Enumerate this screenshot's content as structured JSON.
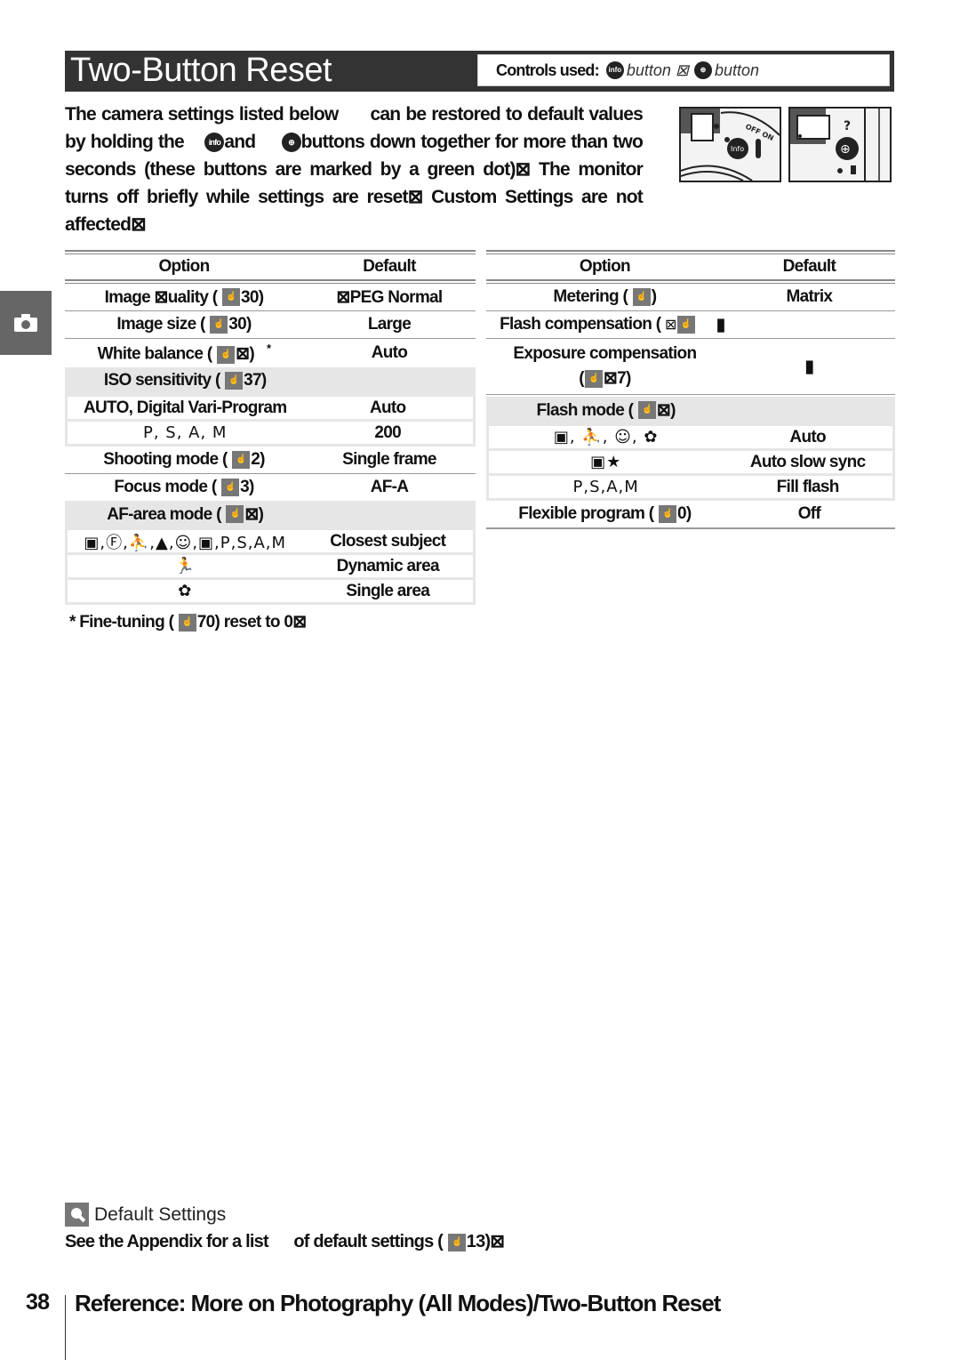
{
  "header": {
    "title": "Two-Button Reset",
    "controls_label": "Controls used:",
    "button1_icon": "info",
    "button1_text": "button ⊠",
    "button2_text": "button",
    "button2_icon": "zoom-in"
  },
  "intro": {
    "p1": "The camera settings listed below",
    "p2": "can be restored to default values by holding the",
    "p3": "and",
    "p4": "buttons down together for more than two seconds (these buttons are marked by a green dot)⊠  The monitor turns off briefly while settings are reset⊠  Custom Settings are not affected⊠",
    "info_icon": "info",
    "zoom_icon": "⊕"
  },
  "side_tab": {
    "icon": "camera-icon"
  },
  "tables": {
    "header": {
      "option": "Option",
      "default": "Default"
    },
    "page_icon": "☝",
    "left": {
      "rows": [
        {
          "option": "Image ⊠uality (",
          "ref": "30)",
          "default": "⊠PEG Normal"
        },
        {
          "option": "Image size (",
          "ref": "30)",
          "default": "Large"
        },
        {
          "option": "White balance (",
          "ref": "⊠)",
          "default": "Auto",
          "note": "*"
        }
      ],
      "iso": {
        "option": "ISO sensitivity (",
        "ref": "37)",
        "subs": [
          {
            "mode": "AUTO, Digital Vari-Program",
            "default": "Auto"
          },
          {
            "mode": "P, S, A, M",
            "default": "200"
          }
        ]
      },
      "rows2": [
        {
          "option": "Shooting mode (",
          "ref": "2)",
          "default": "Single frame"
        },
        {
          "option": "Focus mode (",
          "ref": "3)",
          "default": "AF-A"
        }
      ],
      "afarea": {
        "option": "AF-area mode (",
        "ref": "⊠)",
        "subs": [
          {
            "mode": "AUTO, ⚡̸, portrait, landscape, child, night portrait, P, S, A, M",
            "mode_glyphs": "▣,Ⓕ,⛹,▲,☺,▣,P,S,A,M",
            "default": "Closest subject"
          },
          {
            "mode": "sports",
            "mode_glyphs": "🏃",
            "default": "Dynamic area"
          },
          {
            "mode": "close up",
            "mode_glyphs": "✿",
            "default": "Single area"
          }
        ]
      },
      "footnote": {
        "prefix": "* Fine-tuning (",
        "ref": "70) reset to 0⊠"
      }
    },
    "right": {
      "rows": [
        {
          "option": "Metering (",
          "ref": ")",
          "default": "Matrix"
        },
        {
          "option": "Flash compensation (",
          "ref": "⊠",
          "default": "▮"
        }
      ],
      "exposure": {
        "option_line1": "Exposure compensation",
        "option_line2": "⊠7)",
        "default": "▮"
      },
      "flash": {
        "option": "Flash mode (",
        "ref": "⊠)",
        "subs": [
          {
            "mode": "AUTO, portrait, child, close up",
            "mode_glyphs": "▣, ⛹, ☺, ✿",
            "default": "Auto"
          },
          {
            "mode": "night portrait",
            "mode_glyphs": "▣★",
            "default": "Auto slow sync"
          },
          {
            "mode": "P, S, A, M",
            "mode_glyphs": "P,S,A,M",
            "default": "Fill flash"
          }
        ]
      },
      "rows2": [
        {
          "option": "Flexible program (",
          "ref": "0)",
          "default": "Off"
        }
      ]
    }
  },
  "note": {
    "title": "Default Settings",
    "body_1": "See the Appendix for a list",
    "body_2": "of default settings (",
    "body_ref": "13)⊠"
  },
  "footer": {
    "page_number": "38",
    "title": "Reference: More on Photography (All Modes)/Two-Button Reset"
  }
}
